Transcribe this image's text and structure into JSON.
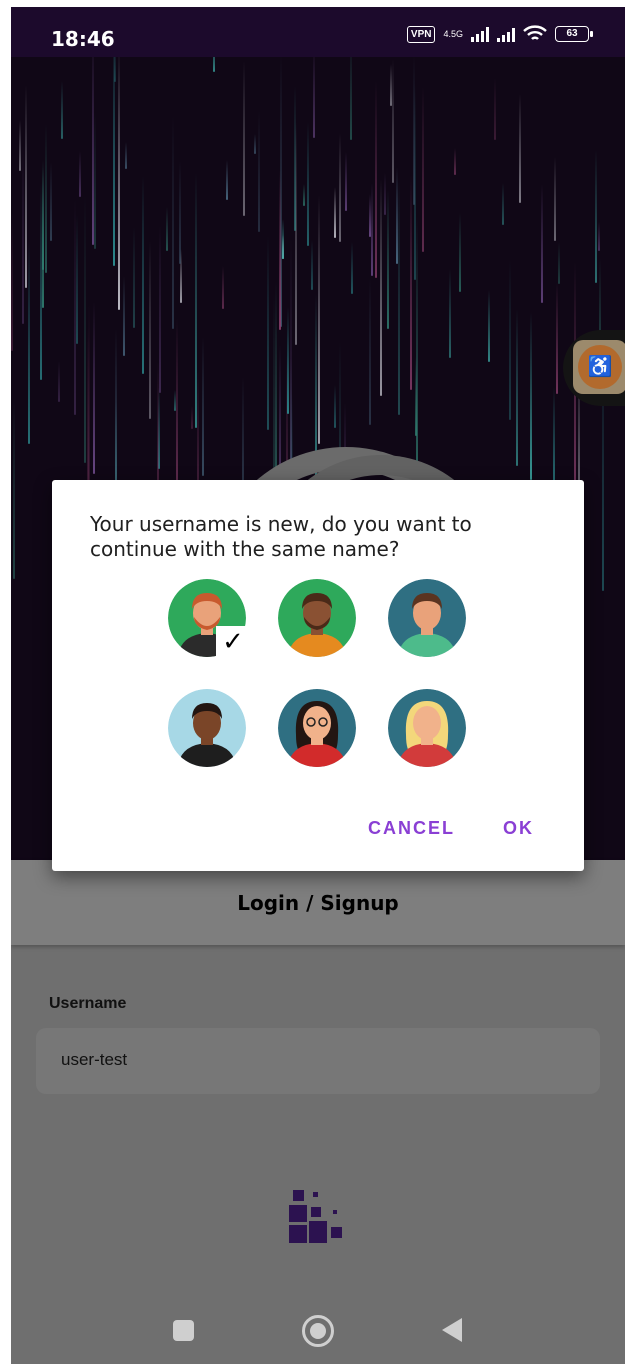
{
  "status_bar": {
    "time": "18:46",
    "vpn": "VPN",
    "network_type": "4.5G",
    "battery": "63"
  },
  "dialog": {
    "message": "Your username is new, do you want to continue with the same name?",
    "selected_avatar_index": 0,
    "avatars": [
      {
        "name": "avatar-man-red-hair",
        "bg": "#2ea95b",
        "skin": "#e9a27a",
        "hair": "#c85a2e",
        "shirt": "#2b2b2b"
      },
      {
        "name": "avatar-man-bald-beard",
        "bg": "#2ea95b",
        "skin": "#8a5133",
        "hair": "#4a2a18",
        "shirt": "#e58a1f"
      },
      {
        "name": "avatar-man-brown-hair",
        "bg": "#2f6f82",
        "skin": "#e9a27a",
        "hair": "#5b3420",
        "shirt": "#4dbb8b"
      },
      {
        "name": "avatar-man-dark-skin",
        "bg": "#a7d8e6",
        "skin": "#7a4528",
        "hair": "#231612",
        "shirt": "#1e1e1e"
      },
      {
        "name": "avatar-woman-glasses",
        "bg": "#2f6f82",
        "skin": "#f1b28b",
        "hair": "#231612",
        "shirt": "#d22b2b"
      },
      {
        "name": "avatar-woman-blonde",
        "bg": "#2f6f82",
        "skin": "#f1b28b",
        "hair": "#f3d77b",
        "shirt": "#d23b3b"
      }
    ],
    "check_mark": "✓",
    "cancel_label": "CANCEL",
    "ok_label": "OK"
  },
  "login": {
    "title": "Login / Signup",
    "username_label": "Username",
    "username_value": "user-test"
  },
  "colors": {
    "accent": "#8a3fd4",
    "status_bar": "#1c0a2c"
  },
  "icons": {
    "floating": "accessibility-icon",
    "nav_recent": "square-icon",
    "nav_home": "circle-icon",
    "nav_back": "triangle-back-icon"
  }
}
